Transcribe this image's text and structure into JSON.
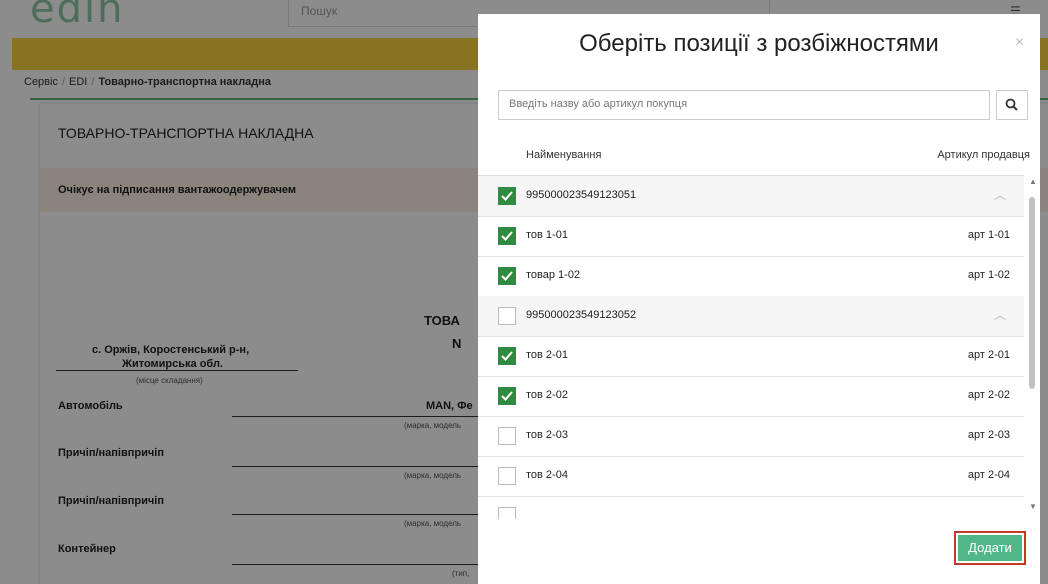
{
  "header": {
    "logo": "edin",
    "search_placeholder": "Пошук"
  },
  "breadcrumbs": [
    "Сервіс",
    "EDI",
    "Товарно-транспортна накладна"
  ],
  "document": {
    "title": "ТОВАРНО-ТРАНСПОРТНА НАКЛАДНА",
    "status": "Очікує на підписання вантажоодержувачем",
    "heading_partial": "ТОВА",
    "number_partial": "N",
    "place_line1": "с. Оржів, Коростенський р-н,",
    "place_line2": "Житомирська обл.",
    "place_caption": "(місце складання)",
    "car_label": "Автомобіль",
    "car_value": "MAN, Фе",
    "car_caption": "(марка, модель",
    "trailer1_label": "Причіп/напівпричіп",
    "trailer1_caption": "(марка, модель",
    "trailer2_label": "Причіп/напівпричіп",
    "trailer2_caption": "(марка, модель",
    "container_label": "Контейнер",
    "container_caption": "(тип,"
  },
  "modal": {
    "title": "Оберіть позиції з розбіжностями",
    "close": "×",
    "search_placeholder": "Введіть назву або артикул покупця",
    "col_name": "Найменування",
    "col_article": "Артикул продавця",
    "add_button": "Додати",
    "rows": [
      {
        "type": "group",
        "checked": true,
        "name": "995000023549123051",
        "article": ""
      },
      {
        "type": "item",
        "checked": true,
        "name": "тов 1-01",
        "article": "арт 1-01"
      },
      {
        "type": "item",
        "checked": true,
        "name": "товар 1-02",
        "article": "арт 1-02"
      },
      {
        "type": "group",
        "checked": false,
        "name": "995000023549123052",
        "article": ""
      },
      {
        "type": "item",
        "checked": true,
        "name": "тов 2-01",
        "article": "арт 2-01"
      },
      {
        "type": "item",
        "checked": true,
        "name": "тов 2-02",
        "article": "арт 2-02"
      },
      {
        "type": "item",
        "checked": false,
        "name": "тов 2-03",
        "article": "арт 2-03"
      },
      {
        "type": "item",
        "checked": false,
        "name": "тов 2-04",
        "article": "арт 2-04"
      },
      {
        "type": "item",
        "checked": false,
        "name": "",
        "article": ""
      }
    ]
  },
  "colors": {
    "accent": "#52b788",
    "check": "#2e8b3f",
    "yellow": "#f6d23d",
    "highlight": "#c0392b"
  }
}
